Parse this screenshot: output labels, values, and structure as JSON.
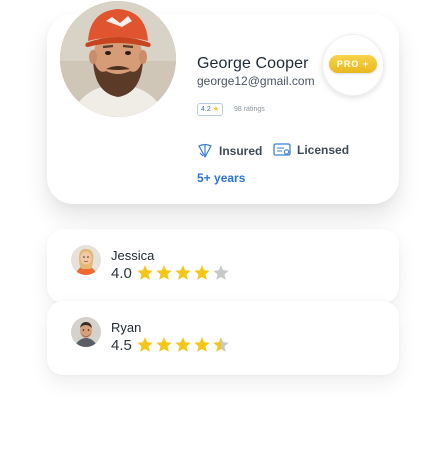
{
  "profile": {
    "name": "George Cooper",
    "email": "george12@gmail.com",
    "rating": "4.2",
    "ratings_count": "98 ratings",
    "badge": "PRO +",
    "credentials": [
      {
        "label": "Insured",
        "icon": "insured-icon"
      },
      {
        "label": "Licensed",
        "icon": "license-icon"
      }
    ],
    "experience": "5+ years"
  },
  "reviews": [
    {
      "name": "Jessica",
      "score": "4.0",
      "stars": 4.0
    },
    {
      "name": "Ryan",
      "score": "4.5",
      "stars": 4.5
    }
  ],
  "colors": {
    "accent": "#2a73d9",
    "star": "#f5c518",
    "star_empty": "#c8c8c8",
    "badge": "#efc533",
    "cap": "#e0542f"
  }
}
